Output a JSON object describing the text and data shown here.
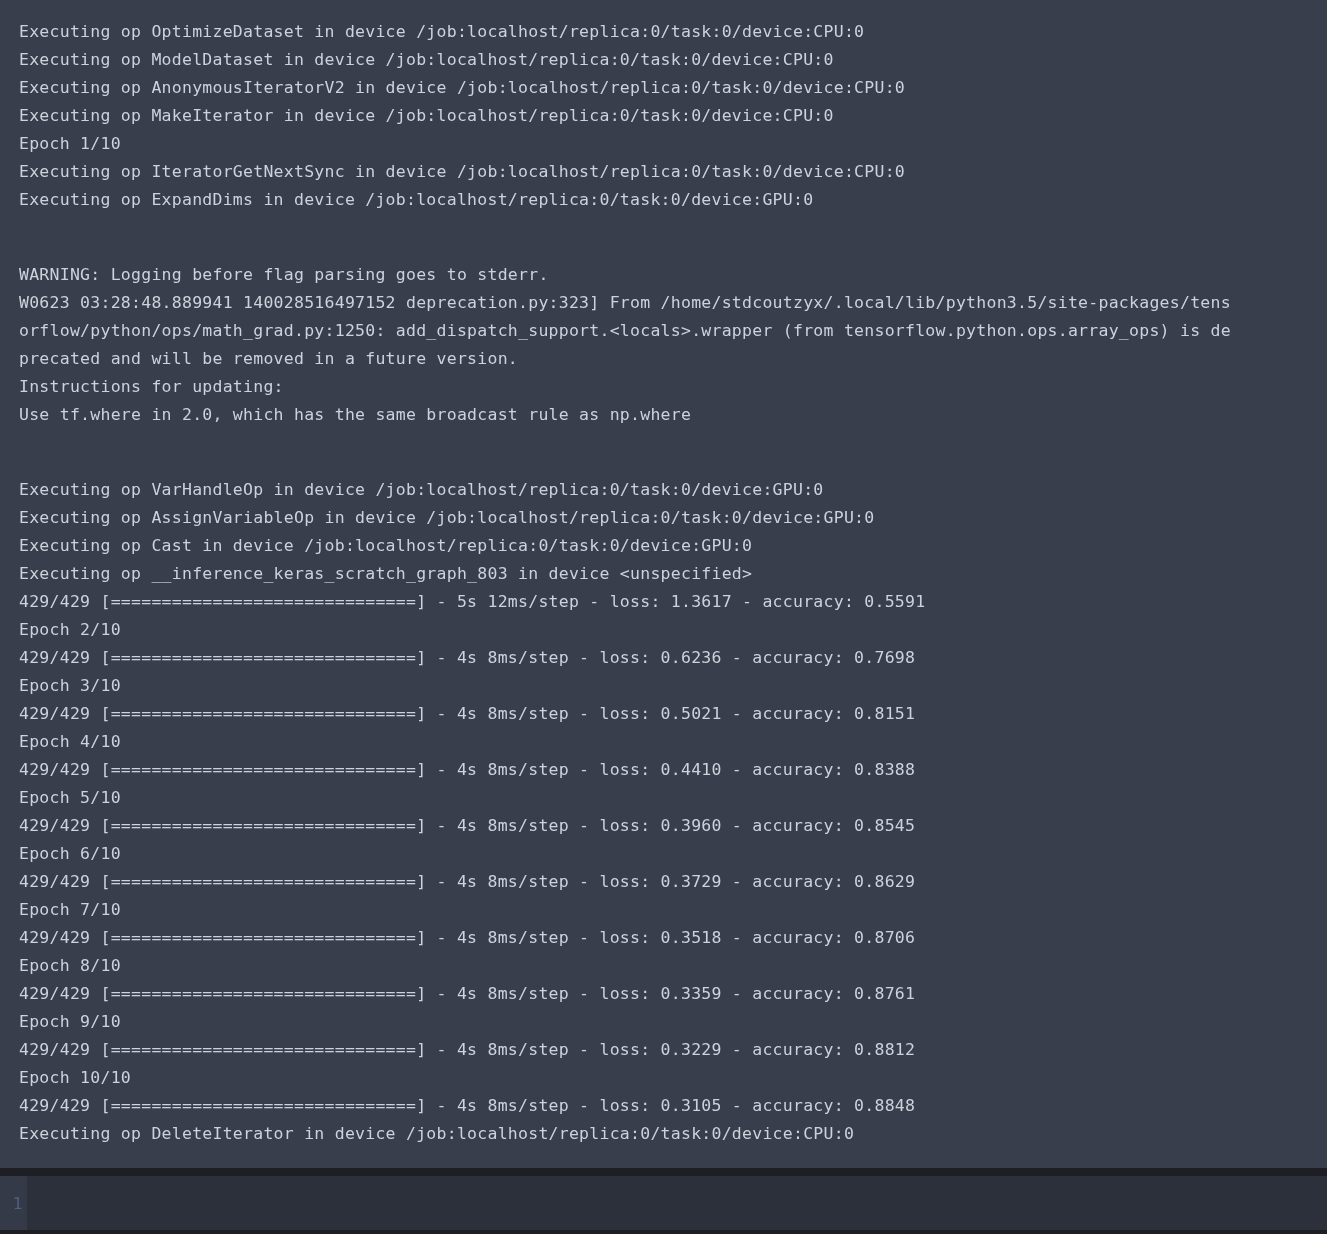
{
  "output": {
    "blocks": [
      {
        "lines": [
          "Executing op OptimizeDataset in device /job:localhost/replica:0/task:0/device:CPU:0",
          "Executing op ModelDataset in device /job:localhost/replica:0/task:0/device:CPU:0",
          "Executing op AnonymousIteratorV2 in device /job:localhost/replica:0/task:0/device:CPU:0",
          "Executing op MakeIterator in device /job:localhost/replica:0/task:0/device:CPU:0",
          "Epoch 1/10",
          "Executing op IteratorGetNextSync in device /job:localhost/replica:0/task:0/device:CPU:0",
          "Executing op ExpandDims in device /job:localhost/replica:0/task:0/device:GPU:0"
        ]
      },
      {
        "lines": [
          "WARNING: Logging before flag parsing goes to stderr.",
          "W0623 03:28:48.889941 140028516497152 deprecation.py:323] From /home/stdcoutzyx/.local/lib/python3.5/site-packages/tens",
          "orflow/python/ops/math_grad.py:1250: add_dispatch_support.<locals>.wrapper (from tensorflow.python.ops.array_ops) is de",
          "precated and will be removed in a future version.",
          "Instructions for updating:",
          "Use tf.where in 2.0, which has the same broadcast rule as np.where"
        ]
      },
      {
        "lines": [
          "Executing op VarHandleOp in device /job:localhost/replica:0/task:0/device:GPU:0",
          "Executing op AssignVariableOp in device /job:localhost/replica:0/task:0/device:GPU:0",
          "Executing op Cast in device /job:localhost/replica:0/task:0/device:GPU:0",
          "Executing op __inference_keras_scratch_graph_803 in device <unspecified>",
          "429/429 [==============================] - 5s 12ms/step - loss: 1.3617 - accuracy: 0.5591",
          "Epoch 2/10",
          "429/429 [==============================] - 4s 8ms/step - loss: 0.6236 - accuracy: 0.7698",
          "Epoch 3/10",
          "429/429 [==============================] - 4s 8ms/step - loss: 0.5021 - accuracy: 0.8151",
          "Epoch 4/10",
          "429/429 [==============================] - 4s 8ms/step - loss: 0.4410 - accuracy: 0.8388",
          "Epoch 5/10",
          "429/429 [==============================] - 4s 8ms/step - loss: 0.3960 - accuracy: 0.8545",
          "Epoch 6/10",
          "429/429 [==============================] - 4s 8ms/step - loss: 0.3729 - accuracy: 0.8629",
          "Epoch 7/10",
          "429/429 [==============================] - 4s 8ms/step - loss: 0.3518 - accuracy: 0.8706",
          "Epoch 8/10",
          "429/429 [==============================] - 4s 8ms/step - loss: 0.3359 - accuracy: 0.8761",
          "Epoch 9/10",
          "429/429 [==============================] - 4s 8ms/step - loss: 0.3229 - accuracy: 0.8812",
          "Epoch 10/10",
          "429/429 [==============================] - 4s 8ms/step - loss: 0.3105 - accuracy: 0.8848",
          "Executing op DeleteIterator in device /job:localhost/replica:0/task:0/device:CPU:0"
        ]
      }
    ]
  },
  "input": {
    "line_number": "1"
  }
}
